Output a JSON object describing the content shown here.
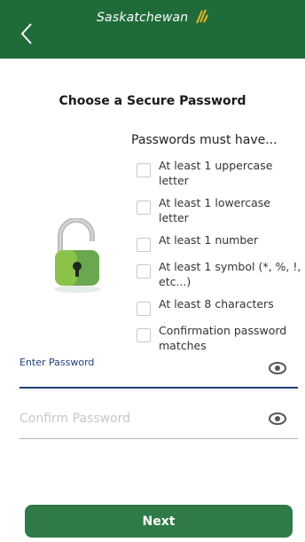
{
  "header": {
    "brand": "Saskatchewan",
    "background": "#1f6b3a"
  },
  "page": {
    "title": "Choose a Secure Password"
  },
  "requirements": {
    "title": "Passwords must have...",
    "items": [
      {
        "label": "At least 1 uppercase letter",
        "checked": false
      },
      {
        "label": "At least 1 lowercase letter",
        "checked": false
      },
      {
        "label": "At least 1 number",
        "checked": false
      },
      {
        "label": "At least 1 symbol (*, %, !, etc...)",
        "checked": false
      },
      {
        "label": "At least 8 characters",
        "checked": false
      },
      {
        "label": "Confirmation password matches",
        "checked": false
      }
    ]
  },
  "password": {
    "label": "Enter Password",
    "value": ""
  },
  "confirm": {
    "placeholder": "Confirm Password",
    "value": ""
  },
  "icons": {
    "back": "chevron-left-icon",
    "lock": "unlocked-padlock-icon",
    "eye": "eye-icon"
  },
  "footer": {
    "next_label": "Next",
    "accent": "#2f7a46"
  }
}
